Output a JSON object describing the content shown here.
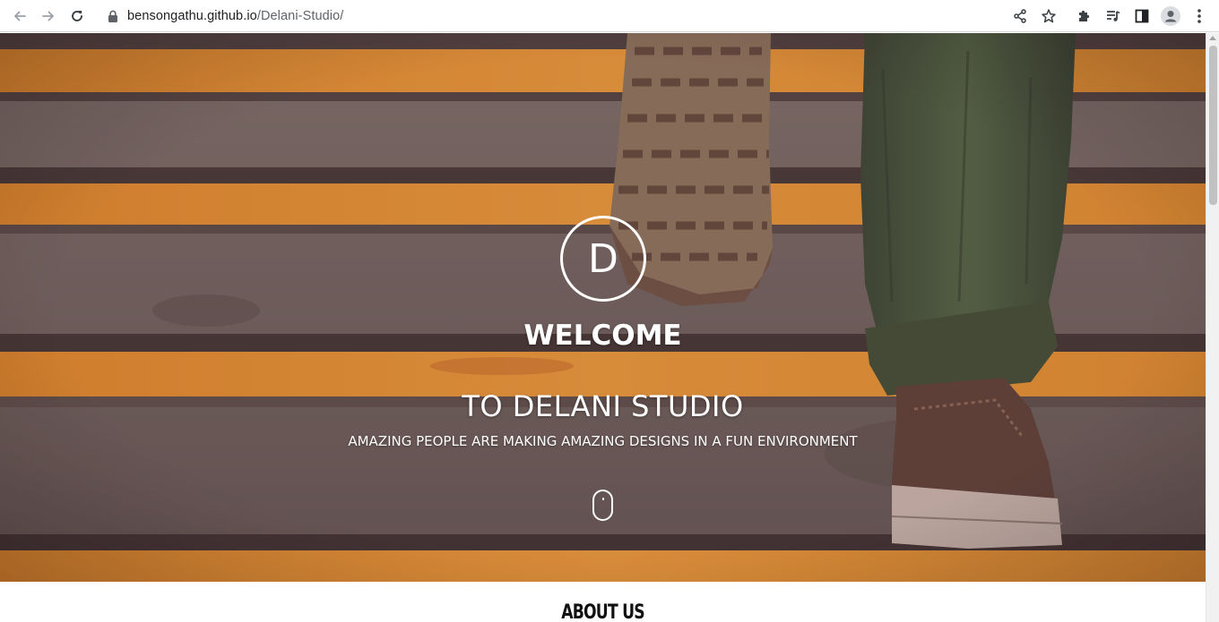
{
  "browser": {
    "url_host": "bensongathu.github.io",
    "url_path": "/Delani-Studio/"
  },
  "icons": {
    "back": "arrow-left-icon",
    "forward": "arrow-right-icon",
    "reload": "reload-icon",
    "lock": "lock-icon",
    "share": "share-icon",
    "bookmark": "star-icon",
    "extensions": "puzzle-icon",
    "media": "media-playlist-icon",
    "sidepanel": "side-panel-icon",
    "profile": "avatar-icon",
    "menu": "kebab-menu-icon",
    "scroll": "mouse-scroll-icon"
  },
  "hero": {
    "logo_letter": "D",
    "welcome": "WELCOME",
    "title": "TO DELANI STUDIO",
    "tagline": "AMAZING PEOPLE ARE MAKING AMAZING DESIGNS IN A FUN ENVIRONMENT"
  },
  "about": {
    "title": "ABOUT US"
  },
  "colors": {
    "stair_yellow": "#e8992a",
    "stair_gray": "#6f6a63",
    "shoe_brown": "#5a4538",
    "pants_green": "#3f5a3a",
    "text_white": "#ffffff"
  }
}
